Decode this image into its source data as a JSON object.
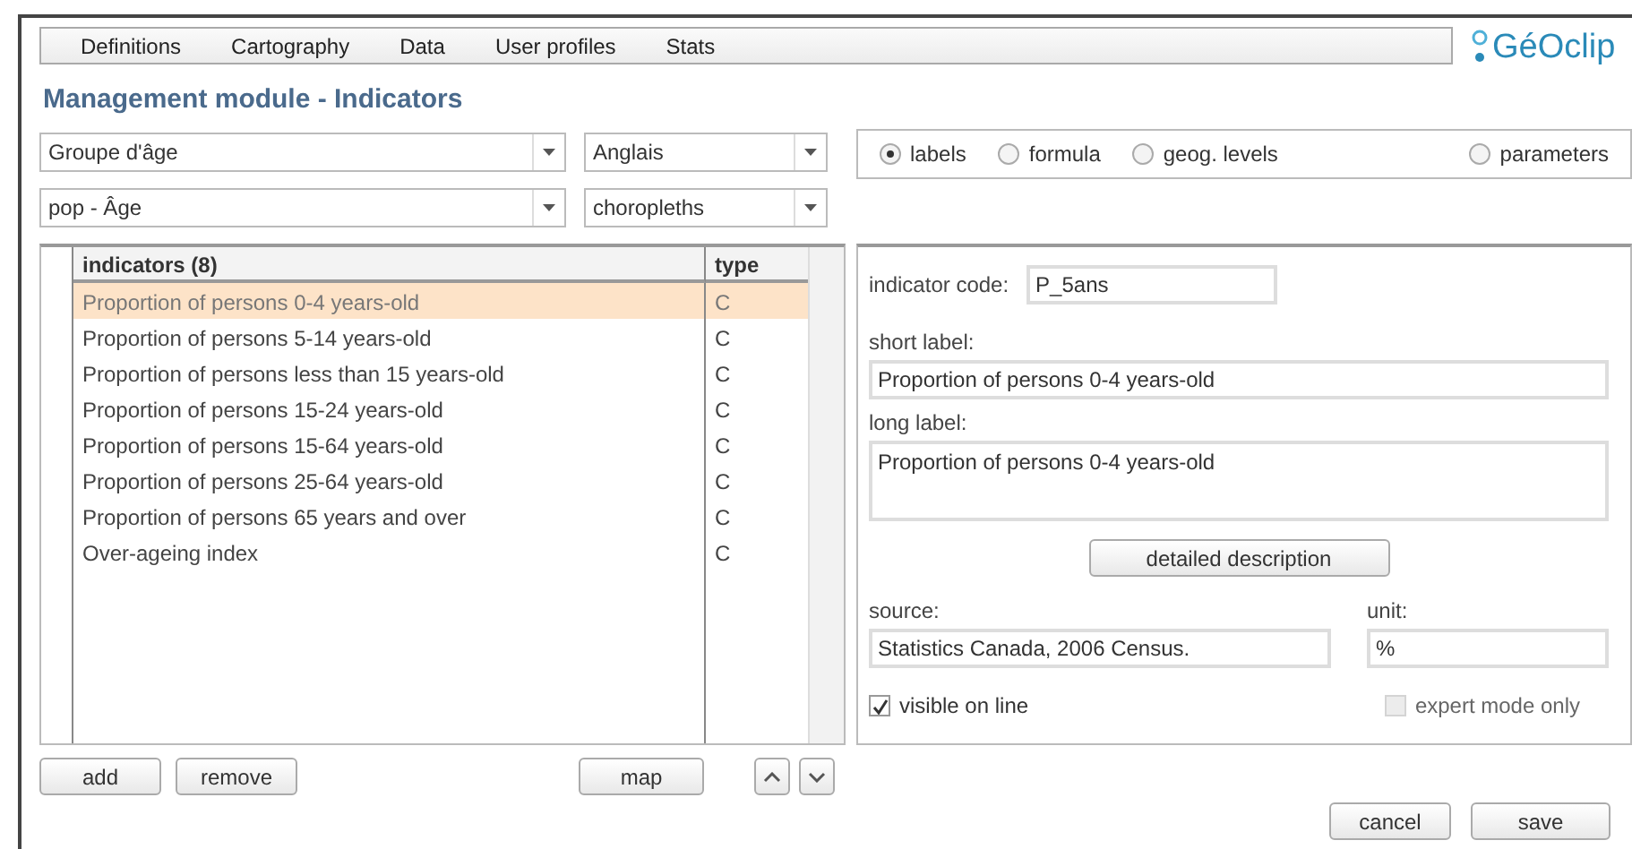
{
  "menu": [
    "Definitions",
    "Cartography",
    "Data",
    "User profiles",
    "Stats"
  ],
  "logo": "GéOclip",
  "title": "Management module - Indicators",
  "selects": [
    {
      "value": "Groupe d'âge",
      "kind": "wide"
    },
    {
      "value": "Anglais",
      "kind": "narrow"
    },
    {
      "value": "pop - Âge",
      "kind": "wide"
    },
    {
      "value": "choropleths",
      "kind": "narrow"
    }
  ],
  "view_options": [
    {
      "label": "labels",
      "selected": true
    },
    {
      "label": "formula",
      "selected": false
    },
    {
      "label": "geog. levels",
      "selected": false
    },
    {
      "label": "parameters",
      "selected": false
    }
  ],
  "table": {
    "columns": [
      "indicators (8)",
      "type"
    ],
    "rows": [
      {
        "name": "Proportion of persons 0-4 years-old",
        "type": "C",
        "selected": true
      },
      {
        "name": "Proportion of persons 5-14 years-old",
        "type": "C",
        "selected": false
      },
      {
        "name": "Proportion of persons less than 15 years-old",
        "type": "C",
        "selected": false
      },
      {
        "name": "Proportion of persons 15-24 years-old",
        "type": "C",
        "selected": false
      },
      {
        "name": "Proportion of persons 15-64 years-old",
        "type": "C",
        "selected": false
      },
      {
        "name": "Proportion of persons 25-64 years-old",
        "type": "C",
        "selected": false
      },
      {
        "name": "Proportion of persons 65 years and over",
        "type": "C",
        "selected": false
      },
      {
        "name": "Over-ageing index",
        "type": "C",
        "selected": false
      }
    ]
  },
  "list_buttons": [
    "add",
    "remove",
    "map"
  ],
  "details": {
    "code_label": "indicator code:",
    "code": "P_5ans",
    "short_label_label": "short label:",
    "short_label": "Proportion of persons 0-4 years-old",
    "long_label_label": "long label:",
    "long_label": "Proportion of persons 0-4 years-old",
    "description_button": "detailed description",
    "source_label": "source:",
    "source": "Statistics Canada, 2006 Census.",
    "unit_label": "unit:",
    "unit": "%",
    "checks": [
      {
        "label": "visible on line",
        "checked": true,
        "disabled": false
      },
      {
        "label": "expert mode only",
        "checked": false,
        "disabled": true
      }
    ]
  },
  "footer_buttons": [
    "cancel",
    "save"
  ]
}
